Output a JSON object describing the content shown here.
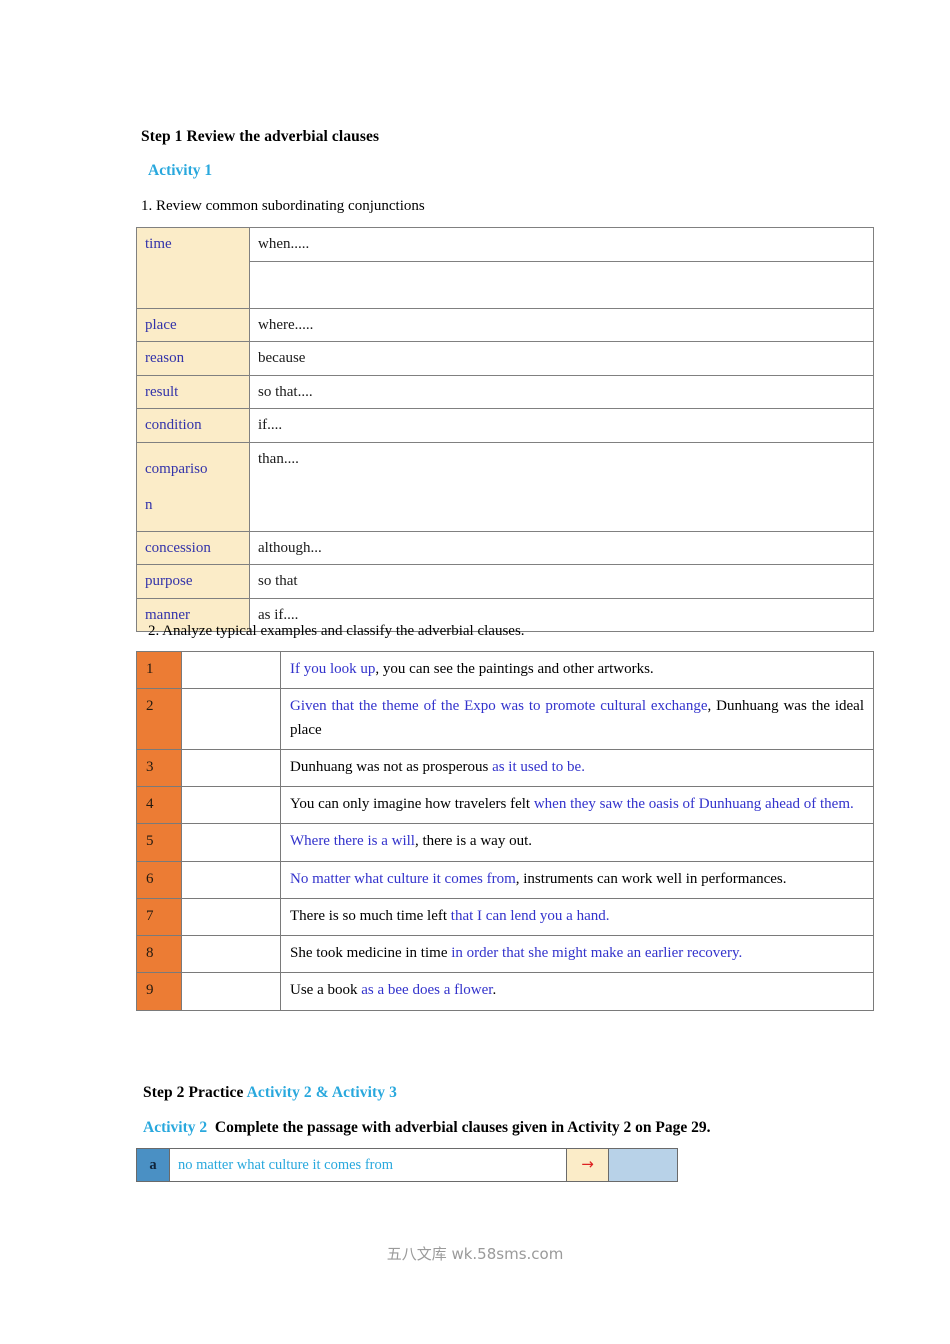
{
  "headings": {
    "step1": "Step 1  Review the adverbial clauses",
    "activity1": "Activity 1",
    "instruction1": "1. Review common subordinating conjunctions",
    "instruction2": "2. Analyze typical examples and classify the adverbial clauses.",
    "step2_prefix": "Step 2  Practice  ",
    "step2_activities": "Activity 2 & Activity 3",
    "activity2_label": "Activity 2",
    "activity2_text": "Complete the passage with adverbial clauses given in Activity 2 on Page 29."
  },
  "conjunction_table": {
    "rows": [
      {
        "label": "time",
        "value": "when.....",
        "extra_blank_row": true
      },
      {
        "label": "place",
        "value": "where....."
      },
      {
        "label": "reason",
        "value": "because"
      },
      {
        "label": "result",
        "value": "so that...."
      },
      {
        "label": "condition",
        "value": "if...."
      },
      {
        "label": "comparison",
        "label_line1": "compariso",
        "label_line2": "n",
        "value": "than....",
        "wrapped": true
      },
      {
        "label": "concession",
        "value": "although..."
      },
      {
        "label": "purpose",
        "value": "so that"
      },
      {
        "label": "manner",
        "value": "as if...."
      }
    ]
  },
  "examples_table": {
    "rows": [
      {
        "index": "1",
        "classification": "",
        "before": "",
        "clause": "If you look up",
        "after": ", you can see the paintings and other artworks."
      },
      {
        "index": "2",
        "classification": "",
        "before": "",
        "clause": "Given that the theme of the Expo was to promote cultural exchange",
        "after": ", Dunhuang was the ideal place"
      },
      {
        "index": "3",
        "classification": "",
        "before": "Dunhuang was not as prosperous ",
        "clause": "as it used to be.",
        "after": ""
      },
      {
        "index": "4",
        "classification": "",
        "before": "You can only imagine how travelers felt ",
        "clause": "when they saw the oasis of Dunhuang ahead of them.",
        "after": ""
      },
      {
        "index": "5",
        "classification": "",
        "before": "",
        "clause": "Where there is a will",
        "after": ", there is a way out."
      },
      {
        "index": "6",
        "classification": "",
        "before": "",
        "clause": "No matter what culture it comes from",
        "after": ", instruments can work well in performances."
      },
      {
        "index": "7",
        "classification": "",
        "before": "There is so much time left ",
        "clause": "that I can lend you a hand.",
        "after": ""
      },
      {
        "index": "8",
        "classification": "",
        "before": "She took medicine in time ",
        "clause": "in order that she might make an earlier recovery.",
        "after": ""
      },
      {
        "index": "9",
        "classification": "",
        "before": "Use a book ",
        "clause": "as a bee does a flower",
        "after": "."
      }
    ]
  },
  "activity2_row": {
    "letter": "a",
    "answer": "no matter what culture it comes from",
    "arrow_icon": "→"
  },
  "watermark": "五八文库 wk.58sms.com",
  "colors": {
    "activity_cyan": "#29a8dd",
    "clause_blue": "#3333cc",
    "label_blue": "#3333aa",
    "cream": "#fbecc8",
    "orange": "#ec7c34",
    "letter_blue": "#4a90c4",
    "swatch_blue": "#b8d2e8",
    "arrow_red": "#dd2222"
  }
}
